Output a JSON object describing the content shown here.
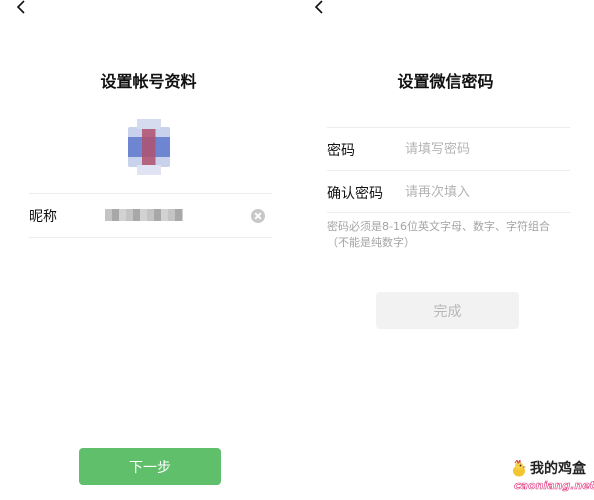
{
  "left": {
    "title": "设置帐号资料",
    "nickname_label": "昵称",
    "next_label": "下一步",
    "next_color": "#5fbf6b"
  },
  "right": {
    "title": "设置微信密码",
    "password_label": "密码",
    "password_placeholder": "请填写密码",
    "confirm_label": "确认密码",
    "confirm_placeholder": "请再次填入",
    "hint_line1": "密码必须是8-16位英文字母、数字、字符组合",
    "hint_line2": "（不能是纯数字）",
    "done_label": "完成"
  },
  "watermark": {
    "title": "我的鸡盒",
    "url": "caoniang.net"
  },
  "icons": [
    "back-icon",
    "avatar",
    "clear-icon",
    "chick-icon"
  ]
}
